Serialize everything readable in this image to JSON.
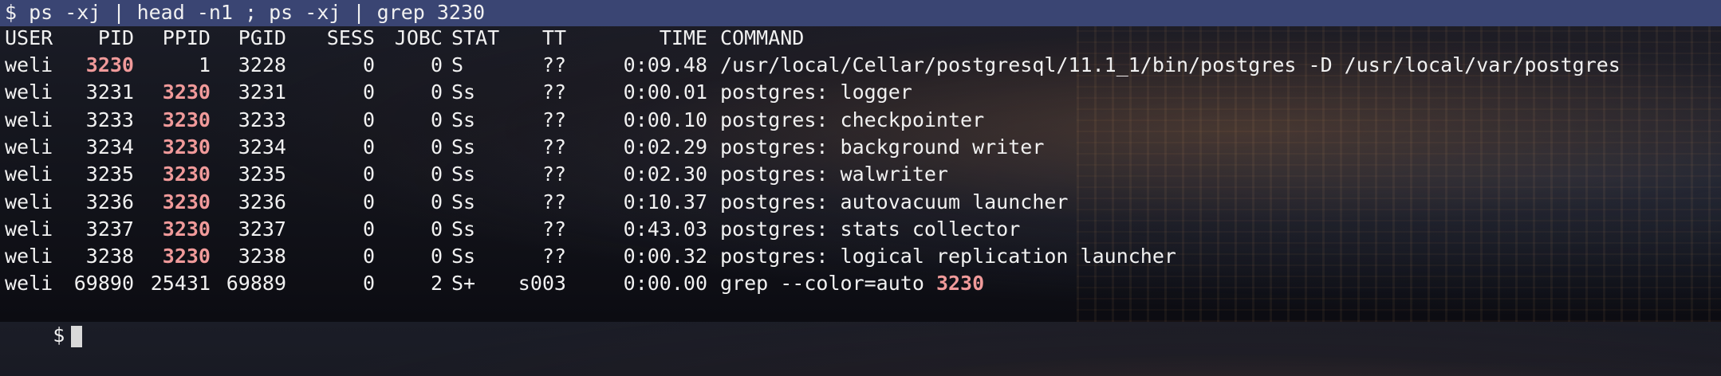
{
  "command_line": "$ ps -xj | head -n1 ; ps -xj | grep 3230",
  "prompt": "$",
  "highlight": "3230",
  "headers": {
    "user": "USER",
    "pid": "PID",
    "ppid": "PPID",
    "pgid": "PGID",
    "sess": "SESS",
    "jobc": "JOBC",
    "stat": "STAT",
    "tt": "TT",
    "time": "TIME",
    "command": "COMMAND"
  },
  "rows": [
    {
      "user": "weli",
      "pid": "3230",
      "ppid": "1",
      "pgid": "3228",
      "sess": "0",
      "jobc": "0",
      "stat": "S",
      "tt": "??",
      "time": "0:09.48",
      "command": "/usr/local/Cellar/postgresql/11.1_1/bin/postgres -D /usr/local/var/postgres"
    },
    {
      "user": "weli",
      "pid": "3231",
      "ppid": "3230",
      "pgid": "3231",
      "sess": "0",
      "jobc": "0",
      "stat": "Ss",
      "tt": "??",
      "time": "0:00.01",
      "command": "postgres: logger"
    },
    {
      "user": "weli",
      "pid": "3233",
      "ppid": "3230",
      "pgid": "3233",
      "sess": "0",
      "jobc": "0",
      "stat": "Ss",
      "tt": "??",
      "time": "0:00.10",
      "command": "postgres: checkpointer"
    },
    {
      "user": "weli",
      "pid": "3234",
      "ppid": "3230",
      "pgid": "3234",
      "sess": "0",
      "jobc": "0",
      "stat": "Ss",
      "tt": "??",
      "time": "0:02.29",
      "command": "postgres: background writer"
    },
    {
      "user": "weli",
      "pid": "3235",
      "ppid": "3230",
      "pgid": "3235",
      "sess": "0",
      "jobc": "0",
      "stat": "Ss",
      "tt": "??",
      "time": "0:02.30",
      "command": "postgres: walwriter"
    },
    {
      "user": "weli",
      "pid": "3236",
      "ppid": "3230",
      "pgid": "3236",
      "sess": "0",
      "jobc": "0",
      "stat": "Ss",
      "tt": "??",
      "time": "0:10.37",
      "command": "postgres: autovacuum launcher"
    },
    {
      "user": "weli",
      "pid": "3237",
      "ppid": "3230",
      "pgid": "3237",
      "sess": "0",
      "jobc": "0",
      "stat": "Ss",
      "tt": "??",
      "time": "0:43.03",
      "command": "postgres: stats collector"
    },
    {
      "user": "weli",
      "pid": "3238",
      "ppid": "3230",
      "pgid": "3238",
      "sess": "0",
      "jobc": "0",
      "stat": "Ss",
      "tt": "??",
      "time": "0:00.32",
      "command": "postgres: logical replication launcher"
    },
    {
      "user": "weli",
      "pid": "69890",
      "ppid": "25431",
      "pgid": "69889",
      "sess": "0",
      "jobc": "2",
      "stat": "S+",
      "tt": "s003",
      "time": "0:00.00",
      "command": "grep --color=auto 3230"
    }
  ],
  "colors": {
    "command_bar": "#3a4573",
    "highlight": "#f09a9a",
    "text": "#f1f1f1"
  }
}
